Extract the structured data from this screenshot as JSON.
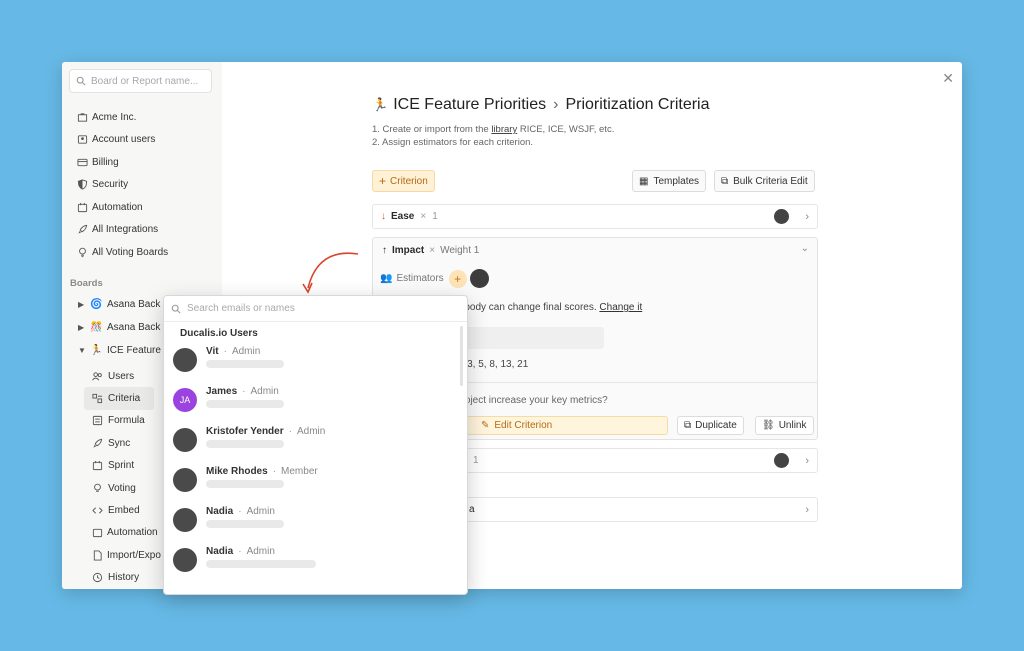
{
  "sidebar": {
    "search_placeholder": "Board or Report name...",
    "items": [
      {
        "label": "Acme Inc.",
        "icon": "building-icon"
      },
      {
        "label": "Account users",
        "icon": "users-icon"
      },
      {
        "label": "Billing",
        "icon": "billing-icon"
      },
      {
        "label": "Security",
        "icon": "shield-icon"
      },
      {
        "label": "Automation",
        "icon": "calendar-icon"
      },
      {
        "label": "All Integrations",
        "icon": "rocket-icon"
      },
      {
        "label": "All Voting Boards",
        "icon": "bulb-icon"
      }
    ],
    "boards_label": "Boards",
    "boards": [
      {
        "label": "Asana Back",
        "icon": "spiral-icon"
      },
      {
        "label": "Asana Back",
        "icon": "confetti-icon"
      },
      {
        "label": "ICE Feature",
        "icon": "person-icon"
      }
    ],
    "sub_items": [
      {
        "label": "Users"
      },
      {
        "label": "Criteria"
      },
      {
        "label": "Formula"
      },
      {
        "label": "Sync"
      },
      {
        "label": "Sprint"
      },
      {
        "label": "Voting"
      },
      {
        "label": "Embed"
      },
      {
        "label": "Automation"
      },
      {
        "label": "Import/Expo"
      },
      {
        "label": "History"
      }
    ]
  },
  "header": {
    "board_title": "ICE Feature Priorities",
    "page_title": "Prioritization Criteria",
    "step1_prefix": "1.  Create or import from the ",
    "step1_link": "library",
    "step1_suffix": " RICE, ICE, WSJF, etc.",
    "step2": "2.  Assign estimators for each criterion."
  },
  "toolbar": {
    "criterion_label": "Criterion",
    "templates_label": "Templates",
    "bulk_label": "Bulk Criteria Edit"
  },
  "criteria": {
    "ease": {
      "name": "Ease",
      "weight": "1"
    },
    "impact": {
      "name": "Impact",
      "weight": "Weight 1",
      "estimators_label": "Estimators",
      "note_text": "rybody can change final scores.",
      "note_link": "Change it",
      "series": "2, 3, 5, 8, 13, 21",
      "question": "project increase your key metrics?",
      "edit_label": "Edit Criterion",
      "duplicate_label": "Duplicate",
      "unlink_label": "Unlink"
    },
    "row3_weight": "1",
    "row4_text": "a"
  },
  "popover": {
    "search_placeholder": "Search emails or names",
    "heading": "Ducalis.io Users",
    "users": [
      {
        "name": "Vit",
        "role": "Admin",
        "initials": ""
      },
      {
        "name": "James",
        "role": "Admin",
        "initials": "JA"
      },
      {
        "name": "Kristofer Yender",
        "role": "Admin",
        "initials": ""
      },
      {
        "name": "Mike Rhodes",
        "role": "Member",
        "initials": ""
      },
      {
        "name": "Nadia",
        "role": "Admin",
        "initials": ""
      },
      {
        "name": "Nadia",
        "role": "Admin",
        "initials": ""
      }
    ]
  },
  "colors": {
    "accent": "#f0a83a",
    "background": "#66b9e6",
    "avatar_purple": "#9b43e0"
  }
}
